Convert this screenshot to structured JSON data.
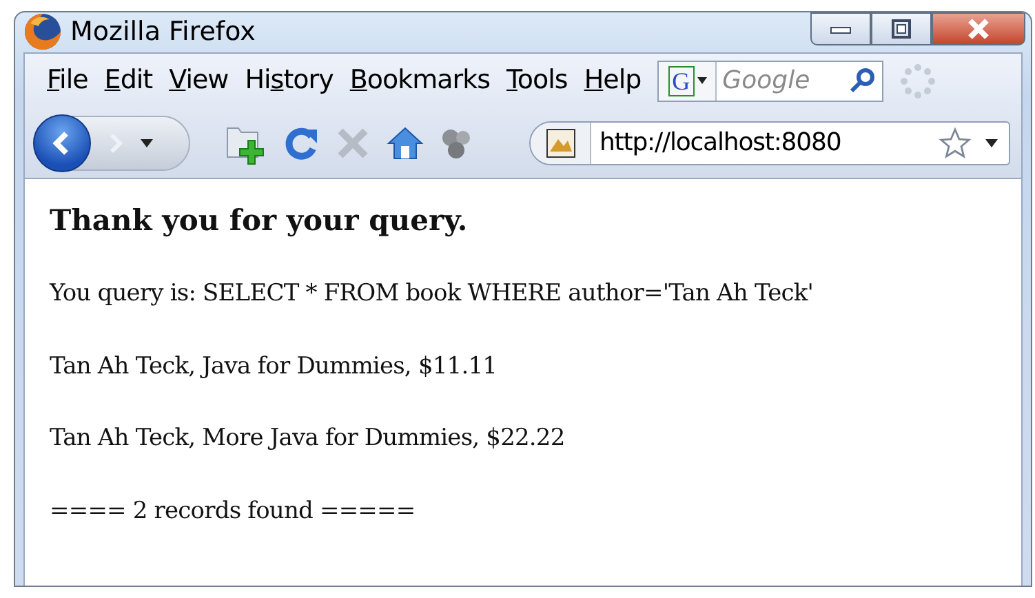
{
  "window": {
    "title": "Mozilla Firefox"
  },
  "menu": [
    {
      "access_key": "F",
      "after": "ile"
    },
    {
      "access_key": "E",
      "after": "dit"
    },
    {
      "access_key": "V",
      "after": "iew"
    },
    {
      "before": "Hi",
      "access_key": "s",
      "after": "tory"
    },
    {
      "access_key": "B",
      "after": "ookmarks"
    },
    {
      "access_key": "T",
      "after": "ools"
    },
    {
      "access_key": "H",
      "after": "elp"
    }
  ],
  "search": {
    "placeholder": "Google",
    "engine": "G"
  },
  "address": {
    "value": "http://localhost:8080"
  },
  "nav": {
    "back_disabled": false,
    "forward_disabled": true,
    "stop_disabled": true
  },
  "content": {
    "heading": "Thank you for your query.",
    "paragraphs": [
      "You query is: SELECT * FROM book WHERE author='Tan Ah Teck'",
      "Tan Ah Teck, Java for Dummies, $11.11",
      "Tan Ah Teck, More Java for Dummies, $22.22",
      "==== 2 records found ====="
    ]
  }
}
